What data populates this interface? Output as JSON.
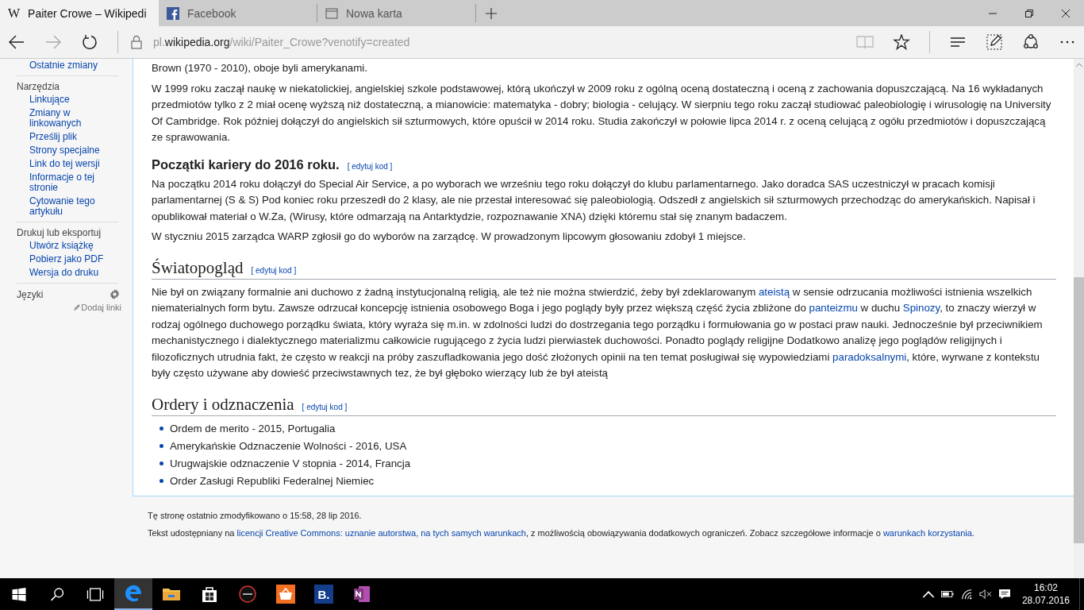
{
  "tabs": [
    {
      "label": "Paiter Crowe – Wikipedi",
      "kind": "wiki",
      "favicon": "W",
      "selected": true
    },
    {
      "label": "Facebook",
      "kind": "facebook",
      "selected": false
    },
    {
      "label": "Nowa karta",
      "kind": "blank",
      "selected": false
    }
  ],
  "address": {
    "prefix": "pl.",
    "domain": "wikipedia.org",
    "path": "/wiki/Paiter_Crowe?venotify=created"
  },
  "nav": {
    "forward_disabled": true,
    "reading_view_disabled": true
  },
  "sidebar": {
    "cut_item": "Ostatnie zmiany",
    "groups": [
      {
        "heading": "Narzędzia",
        "items": [
          "Linkujące",
          "Zmiany w linkowanych",
          "Prześlij plik",
          "Strony specjalne",
          "Link do tej wersji",
          "Informacje o tej stronie",
          "Cytowanie tego artykułu"
        ]
      },
      {
        "heading": "Drukuj lub eksportuj",
        "items": [
          "Utwórz książkę",
          "Pobierz jako PDF",
          "Wersja do druku"
        ]
      }
    ],
    "languages": {
      "heading": "Języki",
      "add": "Dodaj linki"
    }
  },
  "article": [
    {
      "kind": "paragraph",
      "segments": [
        {
          "text": "Brown (1970 - 2010), oboje byli amerykanami.",
          "link": false
        }
      ]
    },
    {
      "kind": "paragraph",
      "segments": [
        {
          "text": "W 1999 roku zaczął naukę w niekatolickiej, angielskiej szkole podstawowej, którą ukończył w 2009 roku z ogólną oceną dostateczną i oceną z zachowania dopuszczającą. Na 16 wykładanych przedmiotów tylko z 2 miał ocenę wyższą niż dostateczną, a mianowicie: matematyka - dobry; biologia - celujący. W sierpniu tego roku zaczął studiować paleobiologię i wirusologię na University Of Cambridge. Rok później dołączył do angielskich sił szturmowych, które opuścił w 2014 roku. Studia zakończył w połowie lipca 2014 r. z oceną celującą z ogółu przedmiotów i dopuszczającą ze sprawowania.",
          "link": false
        }
      ]
    },
    {
      "kind": "h3",
      "title": "Początki kariery do 2016 roku.",
      "edit": "[ edytuj kod ]"
    },
    {
      "kind": "paragraph",
      "segments": [
        {
          "text": "Na początku 2014 roku dołączył do Special Air Service, a po wyborach we wrześniu tego roku dołączył do klubu parlamentarnego. Jako doradca SAS uczestniczył w pracach komisji parlamentarnej (S & S) Pod koniec roku przeszedł do 2 klasy, ale nie przestał interesować się paleobiologią. Odszedł z angielskich sił szturmowych przechodząc do amerykańskich. Napisał i opublikował materiał o W.Za, (Wirusy, które odmarzają na Antarktydzie, rozpoznawanie XNA) dzięki któremu stał się znanym badaczem.",
          "link": false
        }
      ]
    },
    {
      "kind": "paragraph",
      "segments": [
        {
          "text": "W styczniu 2015 zarządca WARP zgłosił go do wyborów na zarządcę. W prowadzonym lipcowym głosowaniu zdobył 1 miejsce.",
          "link": false
        }
      ]
    },
    {
      "kind": "h2",
      "title": "Światopogląd",
      "edit": "[ edytuj kod ]"
    },
    {
      "kind": "paragraph",
      "segments": [
        {
          "text": "Nie był on związany formalnie ani duchowo z żadną instytucjonalną religią, ale też nie można stwierdzić, żeby był zdeklarowanym ",
          "link": false
        },
        {
          "text": "ateistą",
          "link": true
        },
        {
          "text": " w sensie odrzucania możliwości istnienia wszelkich niematerialnych form bytu. Zawsze odrzucał koncepcję istnienia osobowego Boga i jego poglądy były przez większą część życia zbliżone do ",
          "link": false
        },
        {
          "text": "panteizmu",
          "link": true
        },
        {
          "text": " w duchu ",
          "link": false
        },
        {
          "text": "Spinozy",
          "link": true
        },
        {
          "text": ", to znaczy wierzył w rodzaj ogólnego duchowego porządku świata, który wyraża się m.in. w zdolności ludzi do dostrzegania tego porządku i formułowania go w postaci praw nauki. Jednocześnie był przeciwnikiem mechanistycznego i dialektycznego materializmu całkowicie rugującego z życia ludzi pierwiastek duchowości. Ponadto poglądy religijne Dodatkowo analizę jego poglądów religijnych i filozoficznych utrudnia fakt, że często w reakcji na próby zaszufladkowania jego dość złożonych opinii na ten temat posługiwał się wypowiedziami ",
          "link": false
        },
        {
          "text": "paradoksalnymi",
          "link": true
        },
        {
          "text": ", które, wyrwane z kontekstu były często używane aby dowieść przeciwstawnych tez, że był głęboko wierzący lub że był ateistą",
          "link": false
        }
      ]
    },
    {
      "kind": "h2",
      "title": "Ordery i odznaczenia",
      "edit": "[ edytuj kod ]"
    },
    {
      "kind": "list",
      "items": [
        "Ordem de merito - 2015, Portugalia",
        "Amerykańskie Odznaczenie Wolności - 2016, USA",
        "Urugwajskie odznaczenie V stopnia - 2014, Francja",
        "Order Zasługi Republiki Federalnej Niemiec"
      ]
    }
  ],
  "footer": [
    {
      "segments": [
        {
          "text": "Tę stronę ostatnio zmodyfikowano o 15:58, 28 lip 2016.",
          "link": false
        }
      ]
    },
    {
      "segments": [
        {
          "text": "Tekst udostępniany na ",
          "link": false
        },
        {
          "text": "licencji Creative Commons: uznanie autorstwa, na tych samych warunkach",
          "link": true
        },
        {
          "text": ", z możliwością obowiązywania dodatkowych ograniczeń. Zobacz szczegółowe informacje o ",
          "link": false
        },
        {
          "text": "warunkach korzystania",
          "link": true
        },
        {
          "text": ".",
          "link": false
        }
      ]
    }
  ],
  "taskbar": {
    "apps": [
      {
        "kind": "edge",
        "selected": true
      },
      {
        "kind": "explorer",
        "selected": false
      },
      {
        "kind": "store",
        "selected": false
      },
      {
        "kind": "asus",
        "selected": false
      },
      {
        "kind": "basket",
        "selected": false
      },
      {
        "kind": "b",
        "label": "B.",
        "selected": false
      },
      {
        "kind": "onenote",
        "selected": false
      }
    ],
    "time": "16:02",
    "date": "28.07.2016"
  }
}
